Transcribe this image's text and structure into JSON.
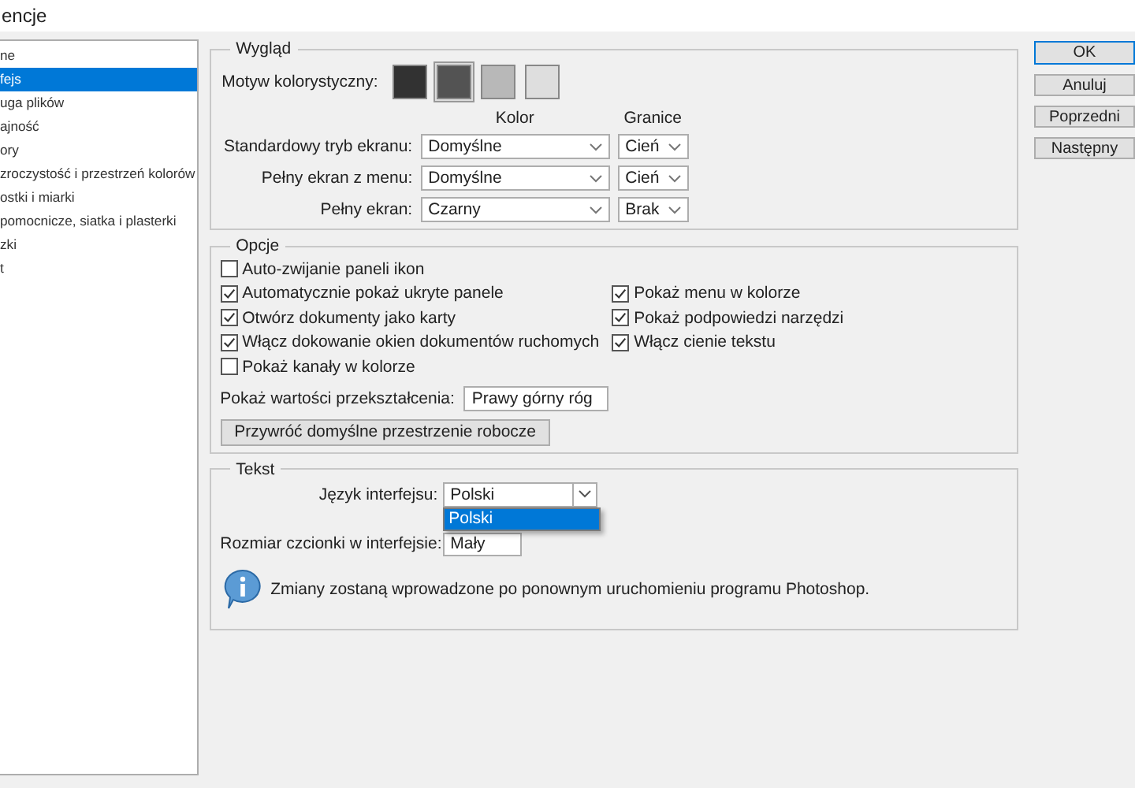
{
  "window": {
    "title": "encje"
  },
  "sidebar": {
    "items": [
      {
        "label": "ne",
        "selected": false
      },
      {
        "label": "fejs",
        "selected": true
      },
      {
        "label": "uga plików",
        "selected": false
      },
      {
        "label": "ajność",
        "selected": false
      },
      {
        "label": "ory",
        "selected": false
      },
      {
        "label": "zroczystość i przestrzeń kolorów",
        "selected": false
      },
      {
        "label": "ostki i miarki",
        "selected": false
      },
      {
        "label": "pomocnicze, siatka i plasterki",
        "selected": false
      },
      {
        "label": "zki",
        "selected": false
      },
      {
        "label": "t",
        "selected": false
      }
    ]
  },
  "appearance": {
    "title": "Wygląd",
    "theme_label": "Motyw kolorystyczny:",
    "themes": [
      {
        "color": "#323232",
        "selected": false
      },
      {
        "color": "#535353",
        "selected": true
      },
      {
        "color": "#b8b8b8",
        "selected": false
      },
      {
        "color": "#dedede",
        "selected": false
      }
    ],
    "column_headers": [
      "Kolor",
      "Granice"
    ],
    "rows": [
      {
        "label": "Standardowy tryb ekranu:",
        "color_mode": "Domyślne",
        "border": "Cień"
      },
      {
        "label": "Pełny ekran z menu:",
        "color_mode": "Domyślne",
        "border": "Cień"
      },
      {
        "label": "Pełny ekran:",
        "color_mode": "Czarny",
        "border": "Brak"
      }
    ]
  },
  "options": {
    "title": "Opcje",
    "left": [
      {
        "label": "Auto-zwijanie paneli ikon",
        "checked": false
      },
      {
        "label": "Automatycznie pokaż ukryte panele",
        "checked": true
      },
      {
        "label": "Otwórz dokumenty jako karty",
        "checked": true
      },
      {
        "label": "Włącz dokowanie okien dokumentów ruchomych",
        "checked": true
      },
      {
        "label": "Pokaż kanały w kolorze",
        "checked": false
      }
    ],
    "right": [
      {
        "label": "Pokaż menu w kolorze",
        "checked": true
      },
      {
        "label": "Pokaż podpowiedzi narzędzi",
        "checked": true
      },
      {
        "label": "Włącz cienie tekstu",
        "checked": true
      }
    ],
    "transform_label": "Pokaż wartości przekształcenia:",
    "transform_value": "Prawy górny róg",
    "reset_button": "Przywróć domyślne przestrzenie robocze"
  },
  "text": {
    "title": "Tekst",
    "language_label": "Język interfejsu:",
    "language_value": "Polski",
    "language_options": [
      {
        "label": "Polski",
        "selected": true
      }
    ],
    "size_label": "Rozmiar czcionki w interfejsie:",
    "size_value": "Mały",
    "info": "Zmiany zostaną wprowadzone po ponownym uruchomieniu programu Photoshop."
  },
  "buttons": [
    {
      "label": "OK",
      "default": true
    },
    {
      "label": "Anuluj",
      "default": false
    },
    {
      "label": "Poprzedni",
      "default": false
    },
    {
      "label": "Następny",
      "default": false
    }
  ]
}
